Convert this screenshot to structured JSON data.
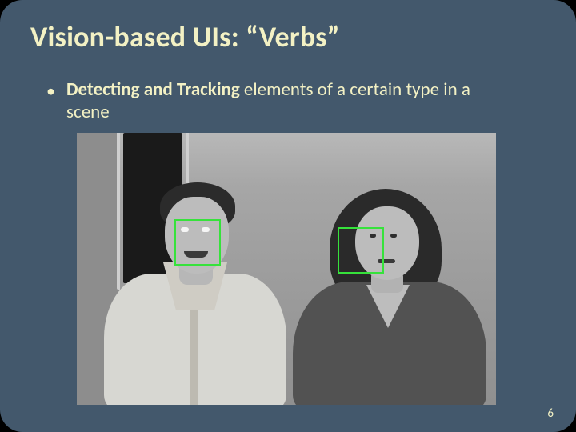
{
  "title": "Vision-based UIs: “Verbs”",
  "bullet": {
    "bold_part": "Detecting and Tracking",
    "rest": " elements of a certain type in a scene"
  },
  "image": {
    "description": "grayscale-photo-two-people-face-detection",
    "tracking_color": "#36e23b"
  },
  "page_number": "6"
}
